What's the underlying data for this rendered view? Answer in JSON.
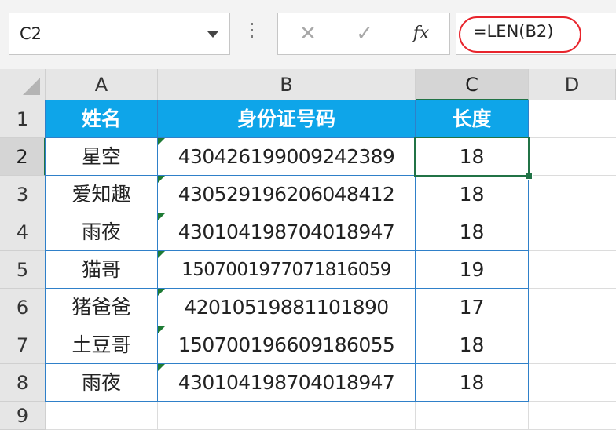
{
  "name_box": {
    "value": "C2"
  },
  "formula_bar": {
    "cancel_icon": "✕",
    "enter_icon": "✓",
    "fx_label": "fx",
    "formula": "=LEN(B2)",
    "highlight_color": "#e8242c"
  },
  "columns": [
    "A",
    "B",
    "C",
    "D"
  ],
  "rows": [
    "1",
    "2",
    "3",
    "4",
    "5",
    "6",
    "7",
    "8",
    "9"
  ],
  "table": {
    "header_color": "#0ea5e9",
    "headers": [
      "姓名",
      "身份证号码",
      "长度"
    ],
    "data": [
      [
        "星空",
        "430426199009242389",
        "18"
      ],
      [
        "爱知趣",
        "430529196206048412",
        "18"
      ],
      [
        "雨夜",
        "430104198704018947",
        "18"
      ],
      [
        "猫哥",
        "150700197707181605​9",
        "19"
      ],
      [
        "猪爸爸",
        "42010519881101890",
        "17"
      ],
      [
        "土豆哥",
        "150700196609186055",
        "18"
      ],
      [
        "雨夜",
        "430104198704018947",
        "18"
      ]
    ]
  },
  "selected_cell": "C2"
}
